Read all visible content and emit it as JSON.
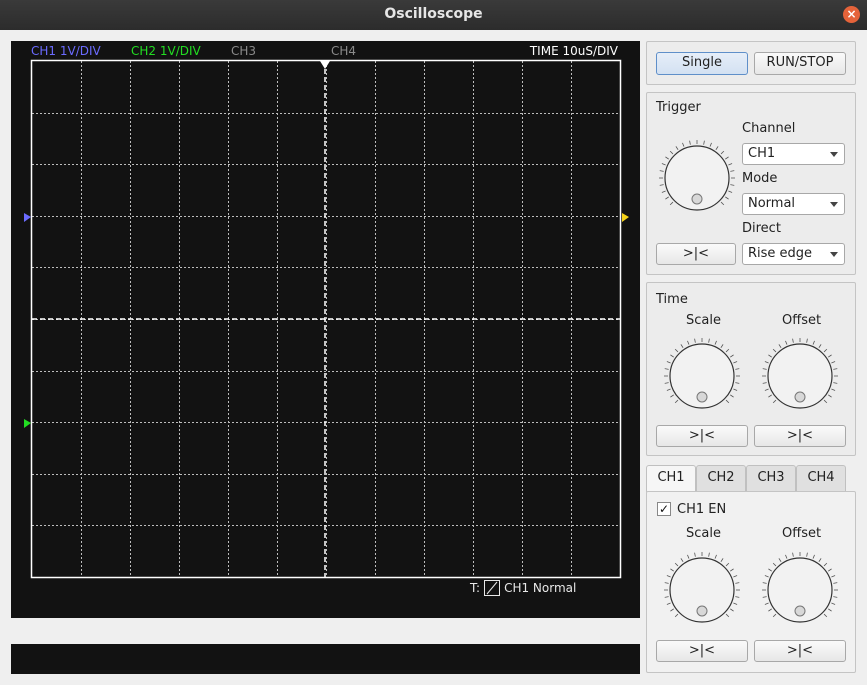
{
  "window": {
    "title": "Oscilloscope"
  },
  "scope": {
    "ch1_label": "CH1 1V/DIV",
    "ch2_label": "CH2 1V/DIV",
    "ch3_label": "CH3",
    "ch4_label": "CH4",
    "time_label": "TIME 10uS/DIV",
    "trigger_status_prefix": "T:",
    "trigger_status_text": "CH1 Normal",
    "colors": {
      "ch1": "#6b6bff",
      "ch2": "#22dd22",
      "ch3": "#8a8a8a",
      "ch4": "#8a8a8a",
      "trigger": "#f5d21a",
      "grid": "#bdbdbd"
    }
  },
  "run_controls": {
    "single_label": "Single",
    "runstop_label": "RUN/STOP"
  },
  "trigger": {
    "title": "Trigger",
    "channel_label": "Channel",
    "channel_value": "CH1",
    "mode_label": "Mode",
    "mode_value": "Normal",
    "direct_label": "Direct",
    "direct_value": "Rise edge",
    "center_label": ">|<"
  },
  "time": {
    "title": "Time",
    "scale_label": "Scale",
    "offset_label": "Offset",
    "scale_reset_label": ">|<",
    "offset_reset_label": ">|<"
  },
  "channel_tabs": [
    "CH1",
    "CH2",
    "CH3",
    "CH4"
  ],
  "channel_panel": {
    "enable_label": "CH1 EN",
    "enable_checked": "✓",
    "scale_label": "Scale",
    "offset_label": "Offset",
    "scale_reset_label": ">|<",
    "offset_reset_label": ">|<"
  }
}
